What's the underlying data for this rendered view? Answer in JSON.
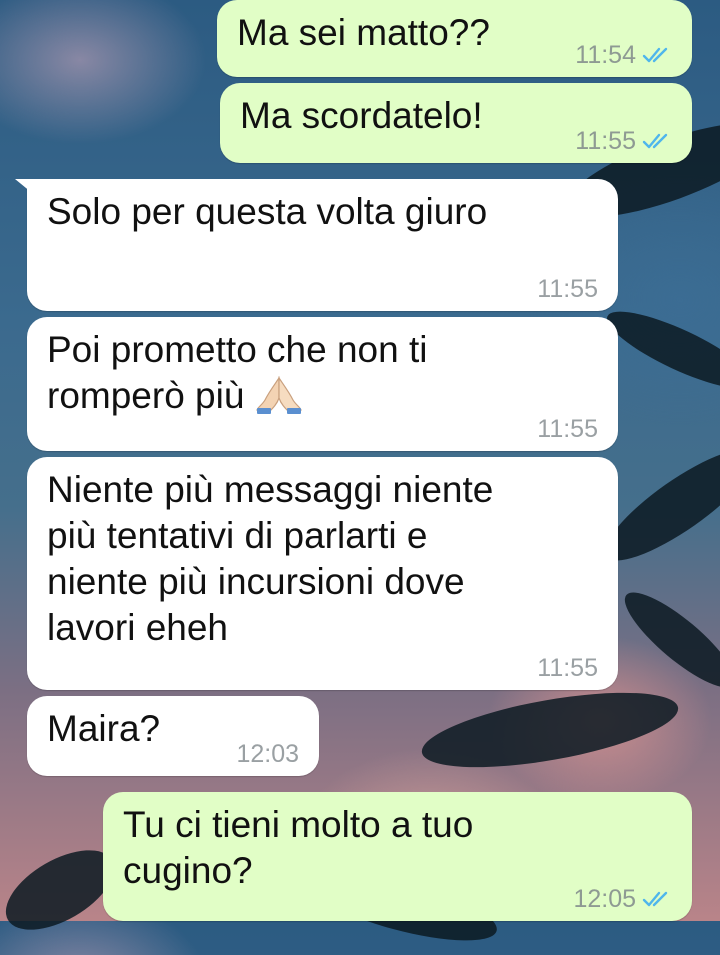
{
  "messages": [
    {
      "text": "Ma sei matto??",
      "time": "11:54",
      "direction": "out",
      "status": "read"
    },
    {
      "text": "Ma scordatelo!",
      "time": "11:55",
      "direction": "out",
      "status": "read"
    },
    {
      "text": "Solo per questa volta giuro",
      "time": "11:55",
      "direction": "in"
    },
    {
      "text": "Poi prometto che non ti\nromperò più",
      "emoji": "folded-hands",
      "time": "11:55",
      "direction": "in"
    },
    {
      "text": "Niente più messaggi niente\npiù tentativi di parlarti e\nniente più incursioni dove\nlavori eheh",
      "time": "11:55",
      "direction": "in"
    },
    {
      "text": "Maira?",
      "time": "12:03",
      "direction": "in"
    },
    {
      "text": "Tu ci tieni molto a tuo\ncugino?",
      "time": "12:05",
      "direction": "out",
      "status": "read"
    }
  ],
  "colors": {
    "outgoing_bubble": "#e1fec6",
    "incoming_bubble": "#ffffff",
    "read_ticks": "#4fb6ec",
    "timestamp": "#8e9a93"
  }
}
